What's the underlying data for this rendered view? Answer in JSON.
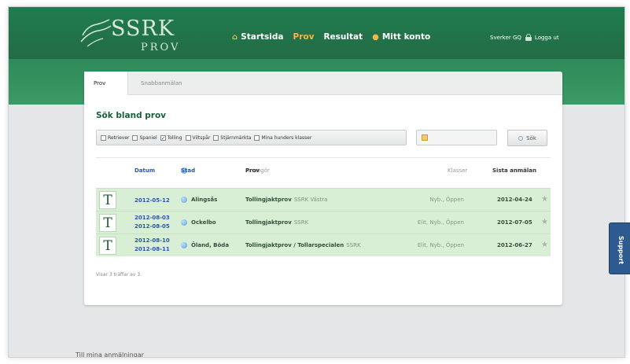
{
  "header": {
    "logo_main": "SSRK",
    "logo_sub": "PROV",
    "nav": [
      {
        "label": "Startsida",
        "icon": "home-icon",
        "active": false
      },
      {
        "label": "Prov",
        "active": true
      },
      {
        "label": "Resultat",
        "active": false
      },
      {
        "label": "Mitt konto",
        "icon": "user-icon",
        "active": false
      }
    ],
    "user_name": "Sverker GQ",
    "logout": "Logga ut"
  },
  "tabs": [
    {
      "label": "Prov",
      "active": true
    },
    {
      "label": "Snabbanmälan",
      "active": false
    }
  ],
  "search": {
    "heading": "Sök bland prov",
    "filters": [
      {
        "label": "Retriever",
        "checked": false
      },
      {
        "label": "Spaniel",
        "checked": false
      },
      {
        "label": "Tolling",
        "checked": true
      },
      {
        "label": "Viltspår",
        "checked": false
      },
      {
        "label": "Stjärnmärkta",
        "checked": false
      },
      {
        "label": "Mina hunders klasser",
        "checked": false
      }
    ],
    "button": "Sök"
  },
  "table": {
    "headers": {
      "date": "Datum",
      "city": "Stad",
      "prov": "Prov",
      "organizer": "Arrangör",
      "klasser": "Klasser",
      "sista": "Sista anmälan"
    },
    "rows": [
      {
        "dates": [
          "2012-05-12"
        ],
        "city": "Alingsås",
        "prov": "Tollingjaktprov",
        "organizer": "SSRK Västra",
        "klasser": "Nyb., Öppen",
        "sista": "2012-04-24"
      },
      {
        "dates": [
          "2012-08-03",
          "2012-08-05"
        ],
        "city": "Ockelbo",
        "prov": "Tollingjaktprov",
        "organizer": "SSRK",
        "klasser": "Elit, Nyb., Öppen",
        "sista": "2012-07-05"
      },
      {
        "dates": [
          "2012-08-10",
          "2012-08-11"
        ],
        "city": "Öland, Böda",
        "prov": "Tollingjaktprov / Tollarspecialen",
        "organizer": "SSRK",
        "klasser": "Elit, Nyb., Öppen",
        "sista": "2012-06-27"
      }
    ],
    "row_letter": "T",
    "showing": "Visar 3 träffar av 3."
  },
  "support": "Support",
  "footer_text": "Till mina anmälningar",
  "colors": {
    "header_green": "#1f7d4f",
    "accent_orange": "#f4b54a",
    "row_green": "#d8efd5",
    "link_blue": "#2a57a6"
  }
}
